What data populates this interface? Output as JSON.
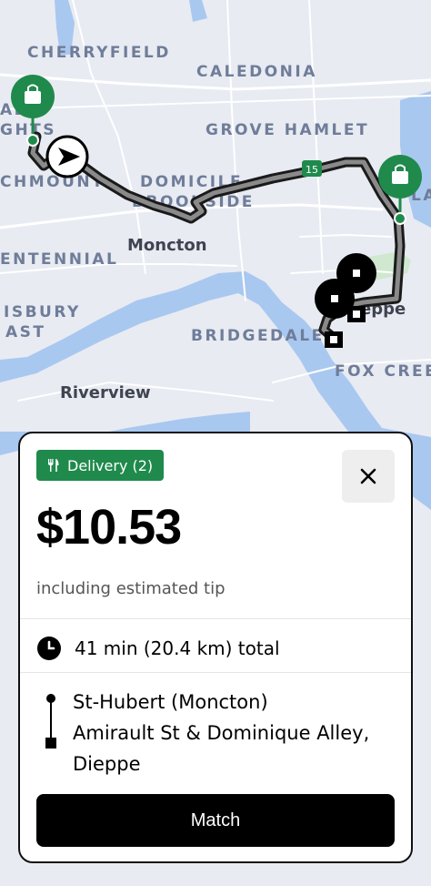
{
  "map": {
    "labels": {
      "cherryfield": "CHERRYFIELD",
      "caledonia": "CALEDONIA",
      "grove_hamlet": "GROVE HAMLET",
      "domicile": "DOMICILE",
      "brookside": "BROOKSIDE",
      "richmount": "CHMOUNT",
      "moncton": "Moncton",
      "centennial": "ENTENNIAL",
      "salisbury": "ISBURY",
      "east": "AST",
      "bridgedale": "BRIDGEDALE",
      "riverview": "Riverview",
      "fox_creek": "FOX CREE",
      "dieppe": "eppe",
      "lakeville": "LAK",
      "glade": "ADE",
      "heights": "GHTS"
    },
    "highway_shield": "15",
    "colors": {
      "land": "#e8ebf2",
      "water": "#a9c8f0",
      "park": "#cfe8cf",
      "route": "#000000",
      "pickup": "#1f8a4c"
    }
  },
  "card": {
    "badge_label": "Delivery (2)",
    "badge_icon": "fork-knife-icon",
    "close_icon": "close-icon",
    "price": "$10.53",
    "tip_note": "including estimated tip",
    "duration": "41 min (20.4 km) total",
    "duration_icon": "clock-icon",
    "route_from": "St-Hubert (Moncton)",
    "route_to": "Amirault St & Dominique Alley, Dieppe",
    "match_label": "Match"
  }
}
